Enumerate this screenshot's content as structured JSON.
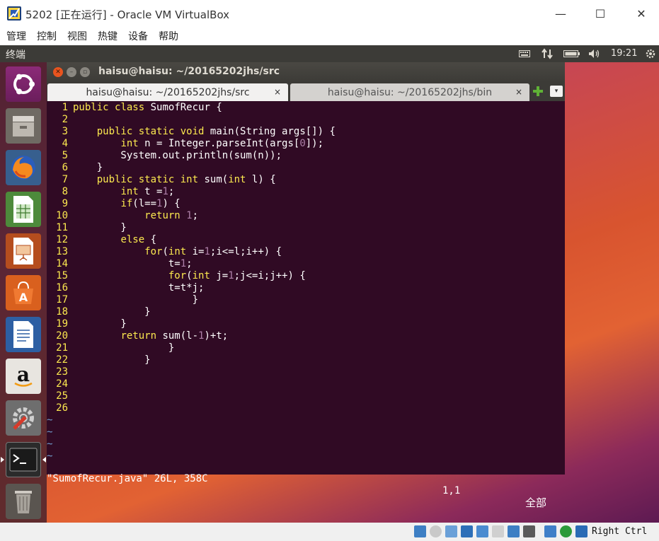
{
  "window": {
    "title": "5202 [正在运行] - Oracle VM VirtualBox",
    "minimize": "—",
    "maximize": "☐",
    "close": "✕"
  },
  "menubar": {
    "items": [
      "管理",
      "控制",
      "视图",
      "热键",
      "设备",
      "帮助"
    ]
  },
  "panel": {
    "title": "终端",
    "clock": "19:21",
    "indicators": [
      "keyboard-icon",
      "network-icon",
      "battery-icon",
      "volume-icon",
      "power-gear-icon"
    ]
  },
  "launcher": {
    "items": [
      "ubuntu-dash-icon",
      "files-icon",
      "firefox-icon",
      "calc-icon",
      "impress-icon",
      "software-center-icon",
      "writer-icon",
      "amazon-icon",
      "settings-icon",
      "terminal-icon",
      "trash-icon"
    ]
  },
  "terminal": {
    "title": "haisu@haisu: ~/20165202jhs/src",
    "tabs": [
      {
        "label": "haisu@haisu: ~/20165202jhs/src",
        "close": "×"
      },
      {
        "label": "haisu@haisu: ~/20165202jhs/bin",
        "close": "×"
      }
    ],
    "menu_glyph": "▾"
  },
  "vim": {
    "lines": [
      {
        "n": "1",
        "text": "public class SumofRecur {"
      },
      {
        "n": "2",
        "text": ""
      },
      {
        "n": "3",
        "text": "    public static void main(String args[]) {"
      },
      {
        "n": "4",
        "text": "        int n = Integer.parseInt(args[0]);"
      },
      {
        "n": "5",
        "text": "        System.out.println(sum(n));"
      },
      {
        "n": "6",
        "text": "    }"
      },
      {
        "n": "7",
        "text": "    public static int sum(int l) {"
      },
      {
        "n": "8",
        "text": "        int t =1;"
      },
      {
        "n": "9",
        "text": "        if(l==1) {"
      },
      {
        "n": "10",
        "text": "            return 1;"
      },
      {
        "n": "11",
        "text": "        }"
      },
      {
        "n": "12",
        "text": "        else {"
      },
      {
        "n": "13",
        "text": "            for(int i=1;i<=l;i++) {"
      },
      {
        "n": "14",
        "text": "                t=1;"
      },
      {
        "n": "15",
        "text": "                for(int j=1;j<=i;j++) {"
      },
      {
        "n": "16",
        "text": "                t=t*j;"
      },
      {
        "n": "17",
        "text": "                    }"
      },
      {
        "n": "18",
        "text": "            }"
      },
      {
        "n": "19",
        "text": "        }"
      },
      {
        "n": "20",
        "text": "        return sum(l-1)+t;"
      },
      {
        "n": "21",
        "text": "                }"
      },
      {
        "n": "22",
        "text": "            }"
      },
      {
        "n": "23",
        "text": ""
      },
      {
        "n": "24",
        "text": ""
      },
      {
        "n": "25",
        "text": ""
      },
      {
        "n": "26",
        "text": ""
      }
    ],
    "tilde": "~",
    "tilde_count": 4,
    "status_file": "\"SumofRecur.java\" 26L, 358C",
    "status_pos": "1,1",
    "status_all": "全部"
  },
  "statusbar": {
    "host_key": "Right Ctrl"
  },
  "colors": {
    "vim_bg": "#300a24",
    "line_number": "#fce94f",
    "keyword": "#fce94f",
    "number_literal": "#ad7fa8",
    "tilde": "#729fcf"
  }
}
